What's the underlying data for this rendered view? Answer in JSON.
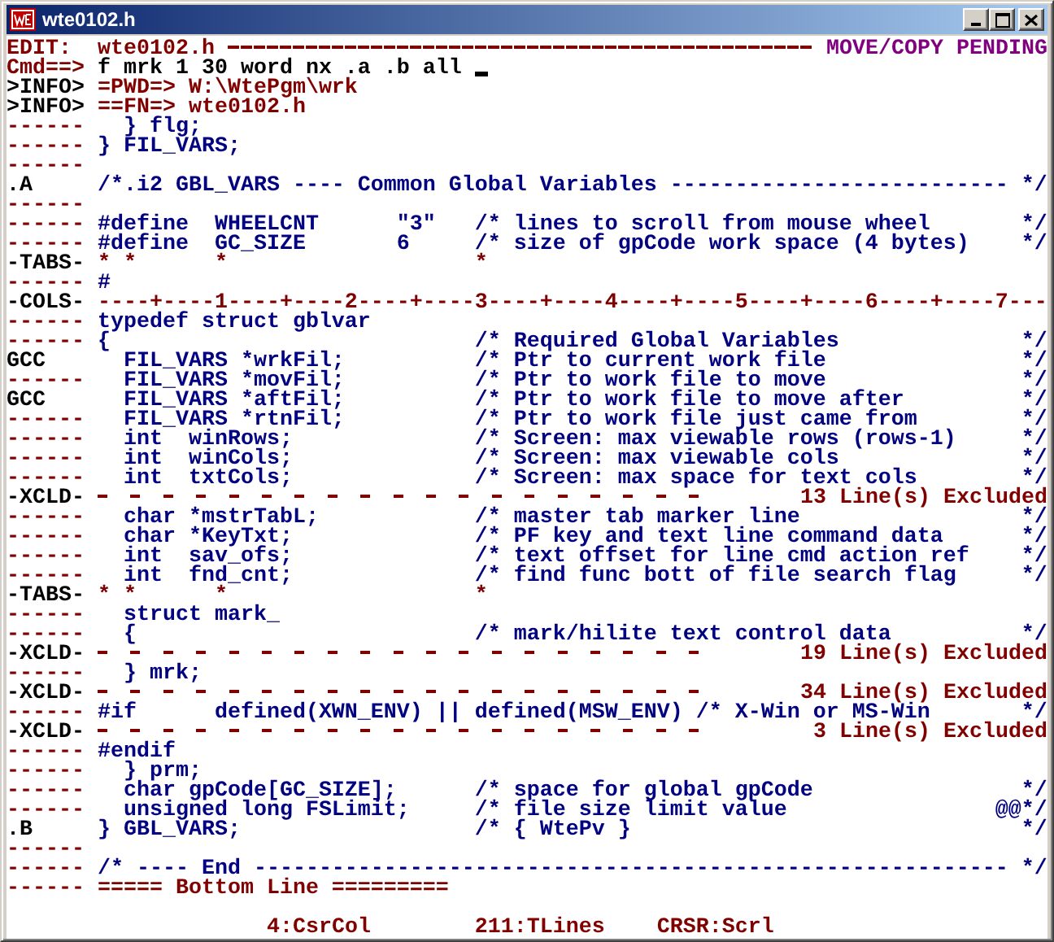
{
  "window": {
    "title": "wte0102.h"
  },
  "editor": {
    "lines": [
      {
        "kind": "header",
        "prefix": "EDIT:",
        "labeled": false,
        "file": "wte0102.h",
        "status": "MOVE/COPY PENDING"
      },
      {
        "kind": "command",
        "prefix": "Cmd==>",
        "labeled": false,
        "text": "f mrk 1 30 word nx .a .b all"
      },
      {
        "kind": "info",
        "prefix": ">INFO>",
        "labeled": true,
        "text": "=PWD=> W:\\WtePgm\\wrk"
      },
      {
        "kind": "info",
        "prefix": ">INFO>",
        "labeled": true,
        "text": "==FN=> wte0102.h"
      },
      {
        "kind": "code",
        "prefix": "------",
        "labeled": false,
        "text": "  } flg;"
      },
      {
        "kind": "code",
        "prefix": "------",
        "labeled": false,
        "text": "} FIL_VARS;"
      },
      {
        "kind": "code",
        "prefix": "------",
        "labeled": false
      },
      {
        "kind": "code",
        "prefix": ".A",
        "labeled": true,
        "text": "/*.i2 GBL_VARS ---- Common Global Variables -------------------------- */"
      },
      {
        "kind": "code",
        "prefix": "------",
        "labeled": false
      },
      {
        "kind": "code",
        "prefix": "------",
        "labeled": false,
        "text": "#define  WHEELCNT      \"3\"   /* lines to scroll from mouse wheel       */"
      },
      {
        "kind": "code",
        "prefix": "------",
        "labeled": false,
        "text": "#define  GC_SIZE       6     /* size of gpCode work space (4 bytes)    */"
      },
      {
        "kind": "tabs",
        "prefix": "-TABS-",
        "labeled": true,
        "text": "* *      *                   *"
      },
      {
        "kind": "code",
        "prefix": "------",
        "labeled": false,
        "text": "#"
      },
      {
        "kind": "cols",
        "prefix": "-COLS-",
        "labeled": true,
        "text": "----+----1----+----2----+----3----+----4----+----5----+----6----+----7---"
      },
      {
        "kind": "code",
        "prefix": "------",
        "labeled": false,
        "text": "typedef struct gblvar"
      },
      {
        "kind": "code",
        "prefix": "------",
        "labeled": false,
        "text": "{                            /* Required Global Variables              */"
      },
      {
        "kind": "code",
        "prefix": "GCC",
        "labeled": true,
        "text": "  FIL_VARS *wrkFil;          /* Ptr to current work file               */"
      },
      {
        "kind": "code",
        "prefix": "------",
        "labeled": false,
        "text": "  FIL_VARS *movFil;          /* Ptr to work file to move               */"
      },
      {
        "kind": "code",
        "prefix": "GCC",
        "labeled": true,
        "text": "  FIL_VARS *aftFil;          /* Ptr to work file to move after         */"
      },
      {
        "kind": "code",
        "prefix": "------",
        "labeled": false,
        "text": "  FIL_VARS *rtnFil;          /* Ptr to work file just came from        */"
      },
      {
        "kind": "code",
        "prefix": "------",
        "labeled": false,
        "text": "  int  winRows;              /* Screen: max viewable rows (rows-1)     */"
      },
      {
        "kind": "code",
        "prefix": "------",
        "labeled": false,
        "text": "  int  winCols;              /* Screen: max viewable cols              */"
      },
      {
        "kind": "code",
        "prefix": "------",
        "labeled": false,
        "text": "  int  txtCols;              /* Screen: max space for text cols        */"
      },
      {
        "kind": "excluded",
        "prefix": "-XCLD-",
        "labeled": true,
        "text": "13 Line(s) Excluded"
      },
      {
        "kind": "code",
        "prefix": "------",
        "labeled": false,
        "text": "  char *mstrTabL;            /* master tab marker line                 */"
      },
      {
        "kind": "code",
        "prefix": "------",
        "labeled": false,
        "text": "  char *KeyTxt;              /* PF key and text line command data      */"
      },
      {
        "kind": "code",
        "prefix": "------",
        "labeled": false,
        "text": "  int  sav_ofs;              /* text offset for line cmd action ref    */"
      },
      {
        "kind": "code",
        "prefix": "------",
        "labeled": false,
        "text": "  int  fnd_cnt;              /* find func bott of file search flag     */"
      },
      {
        "kind": "tabs",
        "prefix": "-TABS-",
        "labeled": true,
        "text": "* *      *                   *"
      },
      {
        "kind": "code",
        "prefix": "------",
        "labeled": false,
        "text": "  struct mark_"
      },
      {
        "kind": "code",
        "prefix": "------",
        "labeled": false,
        "text": "  {                          /* mark/hilite text control data          */"
      },
      {
        "kind": "excluded",
        "prefix": "-XCLD-",
        "labeled": true,
        "text": "19 Line(s) Excluded"
      },
      {
        "kind": "code",
        "prefix": "------",
        "labeled": false,
        "text": "  } mrk;"
      },
      {
        "kind": "excluded",
        "prefix": "-XCLD-",
        "labeled": true,
        "text": "34 Line(s) Excluded"
      },
      {
        "kind": "code",
        "prefix": "------",
        "labeled": false,
        "text": "#if      defined(XWN_ENV) || defined(MSW_ENV) /* X-Win or MS-Win       */"
      },
      {
        "kind": "excluded",
        "prefix": "-XCLD-",
        "labeled": true,
        "text": "3 Line(s) Excluded"
      },
      {
        "kind": "code",
        "prefix": "------",
        "labeled": false,
        "text": "#endif"
      },
      {
        "kind": "code",
        "prefix": "------",
        "labeled": false,
        "text": "  } prm;"
      },
      {
        "kind": "code",
        "prefix": "------",
        "labeled": false,
        "text": "  char gpCode[GC_SIZE];      /* space for global gpCode                */"
      },
      {
        "kind": "code",
        "prefix": "------",
        "labeled": false,
        "text": "  unsigned long FSLimit;     /* file size limit value                @@*/"
      },
      {
        "kind": "code",
        "prefix": ".B",
        "labeled": true,
        "text": "} GBL_VARS;                  /* { WtePv }                              */"
      },
      {
        "kind": "code",
        "prefix": "------",
        "labeled": false
      },
      {
        "kind": "code",
        "prefix": "------",
        "labeled": false,
        "text": "/* ---- End ---------------------------------------------------------- */"
      },
      {
        "kind": "marker",
        "prefix": "------",
        "labeled": false,
        "text": "===== Bottom Line ========="
      }
    ]
  },
  "status_bar": {
    "fields": [
      "4:CsrCol",
      "211:TLines",
      "CRSR:Scrl"
    ]
  }
}
